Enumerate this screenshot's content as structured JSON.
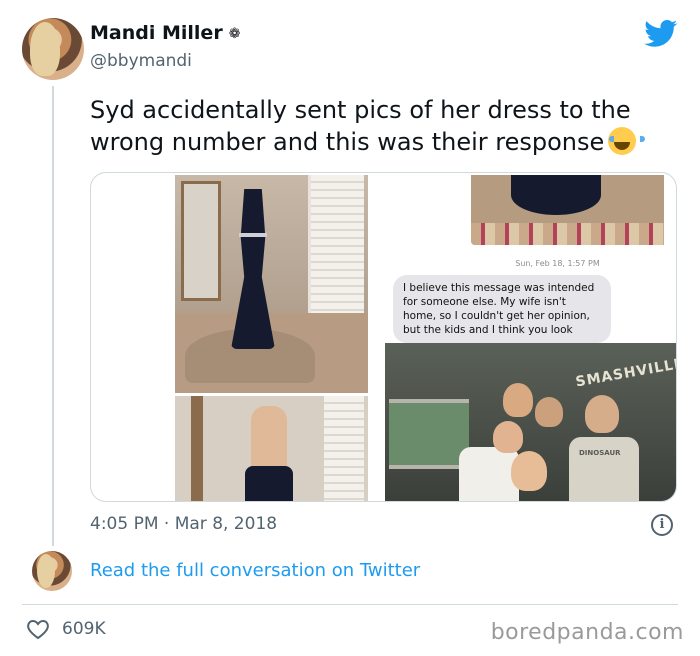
{
  "author": {
    "name": "Mandi Miller",
    "handle": "@bbymandi"
  },
  "tweet": {
    "text": "Syd accidentally sent pics of her dress to the wrong number and this was their response",
    "emoji": "face-with-tears-of-joy-icon",
    "timestamp": "4:05 PM · Mar 8, 2018"
  },
  "media": {
    "message_date": "Sun, Feb 18, 1:57 PM",
    "message_text": "I believe this message was intended for someone else. My wife isn't home, so I couldn't get her opinion, but the kids and I think you look",
    "sign_text": "SMASHVILLE",
    "shirt_text": "DINOSAUR"
  },
  "footer": {
    "read_more": "Read the full conversation on Twitter",
    "likes": "609K"
  },
  "watermark": "boredpanda.com",
  "colors": {
    "accent": "#1d9bf0",
    "secondary_text": "#536471",
    "border": "#cfd9de",
    "twitter_blue": "#1d9bf0"
  }
}
